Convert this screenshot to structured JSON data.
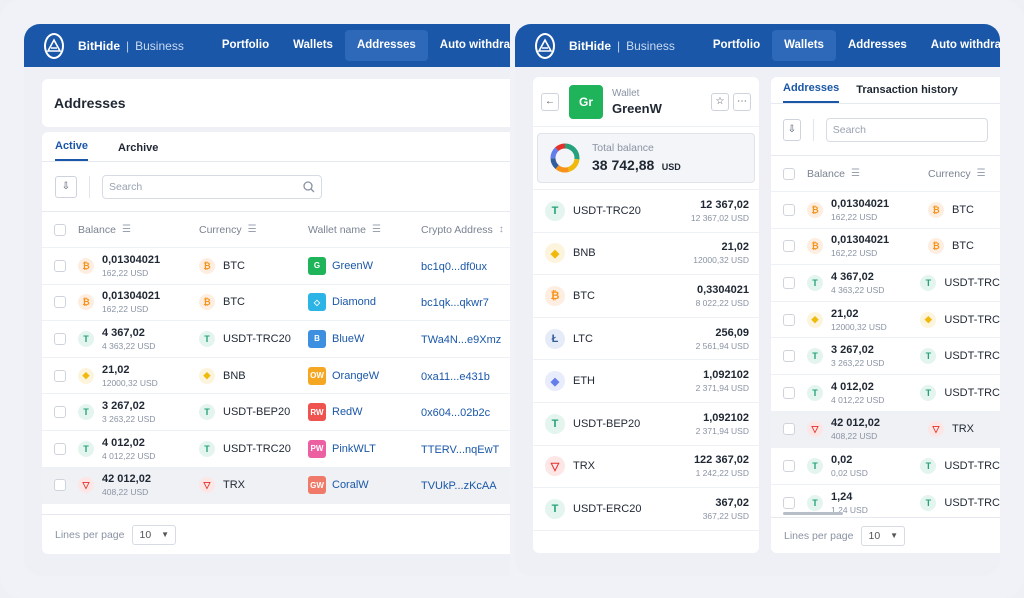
{
  "brand": {
    "name": "BitHide",
    "sub": "Business"
  },
  "nav": [
    "Portfolio",
    "Wallets",
    "Addresses",
    "Auto withdraw"
  ],
  "left": {
    "title": "Addresses",
    "tabs": [
      "Active",
      "Archive"
    ],
    "search_placeholder": "Search",
    "columns": [
      "Balance",
      "Currency",
      "Wallet name",
      "Crypto Address"
    ],
    "rows": [
      {
        "amount": "0,01304021",
        "usd": "162,22 USD",
        "coin": "btc",
        "currency": "BTC",
        "wallet": "GreenW",
        "wallet_badge": "G",
        "wallet_color": "#1fb35a",
        "address": "bc1q0...df0ux"
      },
      {
        "amount": "0,01304021",
        "usd": "162,22 USD",
        "coin": "btc",
        "currency": "BTC",
        "wallet": "Diamond",
        "wallet_badge": "◇",
        "wallet_color": "#2db4e6",
        "address": "bc1qk...qkwr7"
      },
      {
        "amount": "4 367,02",
        "usd": "4 363,22 USD",
        "coin": "usdt",
        "currency": "USDT-TRC20",
        "wallet": "BlueW",
        "wallet_badge": "B",
        "wallet_color": "#3d8fe0",
        "address": "TWa4N...e9Xmz"
      },
      {
        "amount": "21,02",
        "usd": "12000,32 USD",
        "coin": "bnb",
        "currency": "BNB",
        "wallet": "OrangeW",
        "wallet_badge": "OW",
        "wallet_color": "#f5a623",
        "address": "0xa11...e431b"
      },
      {
        "amount": "3 267,02",
        "usd": "3 263,22 USD",
        "coin": "usdt",
        "currency": "USDT-BEP20",
        "wallet": "RedW",
        "wallet_badge": "RW",
        "wallet_color": "#ef5350",
        "address": "0x604...02b2c"
      },
      {
        "amount": "4 012,02",
        "usd": "4 012,22 USD",
        "coin": "usdt",
        "currency": "USDT-TRC20",
        "wallet": "PinkWLT",
        "wallet_badge": "PW",
        "wallet_color": "#ec5fa0",
        "address": "TTERV...nqEwT"
      },
      {
        "amount": "42 012,02",
        "usd": "408,22 USD",
        "coin": "trx",
        "currency": "TRX",
        "wallet": "CoralW",
        "wallet_badge": "GW",
        "wallet_color": "#f07a6a",
        "address": "TVUkP...zKcAA"
      }
    ],
    "lines_per_page_label": "Lines per page",
    "lines_per_page": "10"
  },
  "wallet": {
    "label": "Wallet",
    "name": "GreenW",
    "badge": "Gr",
    "total_label": "Total balance",
    "total_value": "38 742,88",
    "total_unit": "USD",
    "assets": [
      {
        "coin": "usdt",
        "name": "USDT-TRC20",
        "amount": "12 367,02",
        "usd": "12 367,02 USD"
      },
      {
        "coin": "bnb",
        "name": "BNB",
        "amount": "21,02",
        "usd": "12000,32 USD"
      },
      {
        "coin": "btc",
        "name": "BTC",
        "amount": "0,3304021",
        "usd": "8 022,22 USD"
      },
      {
        "coin": "ltc",
        "name": "LTC",
        "amount": "256,09",
        "usd": "2 561,94 USD"
      },
      {
        "coin": "eth",
        "name": "ETH",
        "amount": "1,092102",
        "usd": "2 371,94 USD"
      },
      {
        "coin": "usdt",
        "name": "USDT-BEP20",
        "amount": "1,092102",
        "usd": "2 371,94 USD"
      },
      {
        "coin": "trx",
        "name": "TRX",
        "amount": "122 367,02",
        "usd": "1 242,22 USD"
      },
      {
        "coin": "usdt",
        "name": "USDT-ERC20",
        "amount": "367,02",
        "usd": "367,22 USD"
      }
    ]
  },
  "right": {
    "tabs": [
      "Addresses",
      "Transaction history"
    ],
    "search_placeholder": "Search",
    "columns": [
      "Balance",
      "Currency"
    ],
    "rows": [
      {
        "amount": "0,01304021",
        "usd": "162,22 USD",
        "coin": "btc",
        "currency": "BTC"
      },
      {
        "amount": "0,01304021",
        "usd": "162,22 USD",
        "coin": "btc",
        "currency": "BTC"
      },
      {
        "amount": "4 367,02",
        "usd": "4 363,22 USD",
        "coin": "usdt",
        "currency": "USDT-TRC"
      },
      {
        "amount": "21,02",
        "usd": "12000,32 USD",
        "coin": "bnb",
        "currency": "USDT-TRC"
      },
      {
        "amount": "3 267,02",
        "usd": "3 263,22 USD",
        "coin": "usdt",
        "currency": "USDT-TRC"
      },
      {
        "amount": "4 012,02",
        "usd": "4 012,22 USD",
        "coin": "usdt",
        "currency": "USDT-TRC"
      },
      {
        "amount": "42 012,02",
        "usd": "408,22 USD",
        "coin": "trx",
        "currency": "TRX"
      },
      {
        "amount": "0,02",
        "usd": "0,02 USD",
        "coin": "usdt",
        "currency": "USDT-TRC"
      },
      {
        "amount": "1,24",
        "usd": "1,24 USD",
        "coin": "usdt",
        "currency": "USDT-TRC"
      }
    ],
    "lines_per_page_label": "Lines per page",
    "lines_per_page": "10"
  }
}
